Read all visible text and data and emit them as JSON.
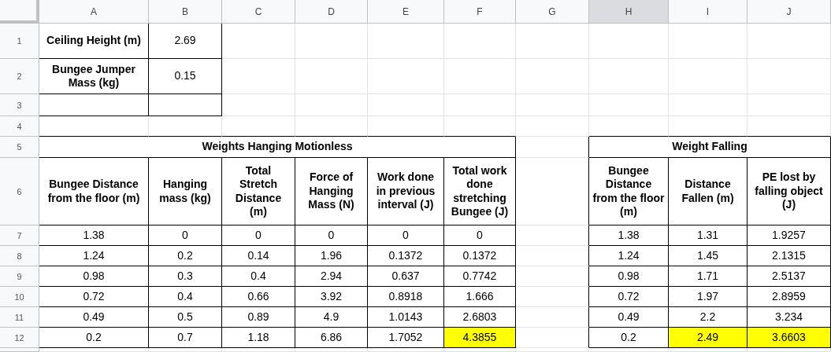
{
  "column_headers": [
    {
      "label": "A",
      "selected": false
    },
    {
      "label": "B",
      "selected": false
    },
    {
      "label": "C",
      "selected": false
    },
    {
      "label": "D",
      "selected": false
    },
    {
      "label": "E",
      "selected": false
    },
    {
      "label": "F",
      "selected": false
    },
    {
      "label": "G",
      "selected": false
    },
    {
      "label": "H",
      "selected": true
    },
    {
      "label": "I",
      "selected": false
    },
    {
      "label": "J",
      "selected": false
    }
  ],
  "row_headers": [
    "1",
    "2",
    "3",
    "4",
    "5",
    "6",
    "7",
    "8",
    "9",
    "10",
    "11",
    "12"
  ],
  "info_table": {
    "rows": [
      {
        "label": "Ceiling Height (m)",
        "value": "2.69"
      },
      {
        "label": "Bungee Jumper Mass (kg)",
        "value": "0.15"
      }
    ]
  },
  "motionless_table": {
    "title": "Weights Hanging Motionless",
    "columns": [
      "Bungee Distance from the floor (m)",
      "Hanging mass (kg)",
      "Total Stretch Distance (m)",
      "Force of Hanging Mass (N)",
      "Work done in previous interval (J)",
      "Total work done stretching Bungee (J)"
    ],
    "rows": [
      {
        "cells": [
          {
            "text": "1.38",
            "highlighted": false
          },
          {
            "text": "0",
            "highlighted": false
          },
          {
            "text": "0",
            "highlighted": false
          },
          {
            "text": "0",
            "highlighted": false
          },
          {
            "text": "0",
            "highlighted": false
          },
          {
            "text": "0",
            "highlighted": false
          }
        ]
      },
      {
        "cells": [
          {
            "text": "1.24",
            "highlighted": false
          },
          {
            "text": "0.2",
            "highlighted": false
          },
          {
            "text": "0.14",
            "highlighted": false
          },
          {
            "text": "1.96",
            "highlighted": false
          },
          {
            "text": "0.1372",
            "highlighted": false
          },
          {
            "text": "0.1372",
            "highlighted": false
          }
        ]
      },
      {
        "cells": [
          {
            "text": "0.98",
            "highlighted": false
          },
          {
            "text": "0.3",
            "highlighted": false
          },
          {
            "text": "0.4",
            "highlighted": false
          },
          {
            "text": "2.94",
            "highlighted": false
          },
          {
            "text": "0.637",
            "highlighted": false
          },
          {
            "text": "0.7742",
            "highlighted": false
          }
        ]
      },
      {
        "cells": [
          {
            "text": "0.72",
            "highlighted": false
          },
          {
            "text": "0.4",
            "highlighted": false
          },
          {
            "text": "0.66",
            "highlighted": false
          },
          {
            "text": "3.92",
            "highlighted": false
          },
          {
            "text": "0.8918",
            "highlighted": false
          },
          {
            "text": "1.666",
            "highlighted": false
          }
        ]
      },
      {
        "cells": [
          {
            "text": "0.49",
            "highlighted": false
          },
          {
            "text": "0.5",
            "highlighted": false
          },
          {
            "text": "0.89",
            "highlighted": false
          },
          {
            "text": "4.9",
            "highlighted": false
          },
          {
            "text": "1.0143",
            "highlighted": false
          },
          {
            "text": "2.6803",
            "highlighted": false
          }
        ]
      },
      {
        "cells": [
          {
            "text": "0.2",
            "highlighted": false
          },
          {
            "text": "0.7",
            "highlighted": false
          },
          {
            "text": "1.18",
            "highlighted": false
          },
          {
            "text": "6.86",
            "highlighted": false
          },
          {
            "text": "1.7052",
            "highlighted": false
          },
          {
            "text": "4.3855",
            "highlighted": true
          }
        ]
      }
    ]
  },
  "falling_table": {
    "title": "Weight Falling",
    "columns": [
      "Bungee Distance from the floor (m)",
      "Distance Fallen (m)",
      "PE lost by falling object (J)"
    ],
    "rows": [
      {
        "cells": [
          {
            "text": "1.38",
            "highlighted": false
          },
          {
            "text": "1.31",
            "highlighted": false
          },
          {
            "text": "1.9257",
            "highlighted": false
          }
        ]
      },
      {
        "cells": [
          {
            "text": "1.24",
            "highlighted": false
          },
          {
            "text": "1.45",
            "highlighted": false
          },
          {
            "text": "2.1315",
            "highlighted": false
          }
        ]
      },
      {
        "cells": [
          {
            "text": "0.98",
            "highlighted": false
          },
          {
            "text": "1.71",
            "highlighted": false
          },
          {
            "text": "2.5137",
            "highlighted": false
          }
        ]
      },
      {
        "cells": [
          {
            "text": "0.72",
            "highlighted": false
          },
          {
            "text": "1.97",
            "highlighted": false
          },
          {
            "text": "2.8959",
            "highlighted": false
          }
        ]
      },
      {
        "cells": [
          {
            "text": "0.49",
            "highlighted": false
          },
          {
            "text": "2.2",
            "highlighted": false
          },
          {
            "text": "3.234",
            "highlighted": false
          }
        ]
      },
      {
        "cells": [
          {
            "text": "0.2",
            "highlighted": false
          },
          {
            "text": "2.49",
            "highlighted": true
          },
          {
            "text": "3.6603",
            "highlighted": true
          }
        ]
      }
    ]
  }
}
